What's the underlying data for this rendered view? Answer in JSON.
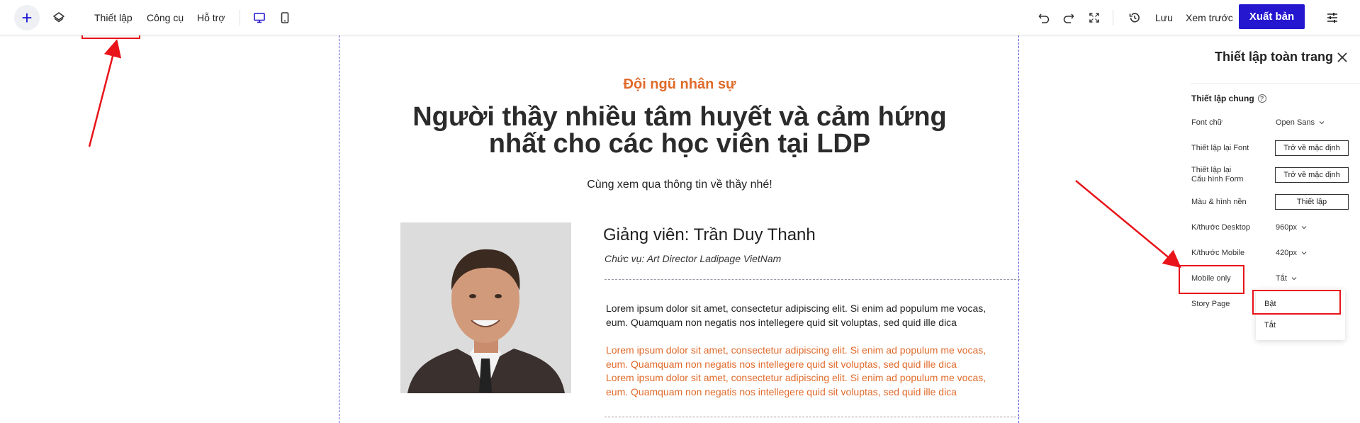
{
  "toolbar": {
    "add_label": "+",
    "menu": [
      "Thiết lập",
      "Công cụ",
      "Hỗ trợ"
    ],
    "save_label": "Lưu",
    "preview_label": "Xem trước",
    "publish_label": "Xuất bản",
    "icons": [
      "plus-icon",
      "layers-icon",
      "desktop-icon",
      "mobile-icon",
      "undo-icon",
      "redo-icon",
      "fullscreen-icon",
      "history-icon",
      "sliders-icon"
    ]
  },
  "canvas": {
    "subheading": "Đội ngũ nhân sự",
    "heading_line1": "Người thầy nhiều tâm huyết và cảm hứng",
    "heading_line2": "nhất cho các học viên tại LDP",
    "lead": "Cùng xem qua thông tin về thầy nhé!",
    "teacher_name": "Giảng viên: Trần Duy Thanh",
    "teacher_role": "Chức vụ: Art Director Ladipage VietNam",
    "para1": "Lorem ipsum dolor sit amet, consectetur adipiscing elit. Si enim ad populum me vocas, eum. Quamquam non negatis nos intellegere quid sit voluptas, sed quid ille dica",
    "para2": "Lorem ipsum dolor sit amet, consectetur adipiscing elit. Si enim ad populum me vocas, eum. Quamquam non negatis nos intellegere quid sit voluptas, sed quid ille dica",
    "para3": "Lorem ipsum dolor sit amet, consectetur adipiscing elit. Si enim ad populum me vocas, eum. Quamquam non negatis nos intellegere quid sit voluptas, sed quid ille dica"
  },
  "panel": {
    "title": "Thiết lập toàn trang",
    "section_title": "Thiết lập chung",
    "rows": {
      "font_label": "Font chữ",
      "font_value": "Open Sans",
      "reset_font_label": "Thiết lập lại Font",
      "reset_font_button": "Trở về mặc định",
      "reset_form_label_1": "Thiết lập lại",
      "reset_form_label_2": "Cấu hình Form",
      "reset_form_button": "Trở về mặc định",
      "color_label": "Màu & hình nền",
      "color_button": "Thiết lập",
      "desktop_label": "K/thước Desktop",
      "desktop_value": "960px",
      "mobile_label": "K/thước Mobile",
      "mobile_value": "420px",
      "mobile_only_label": "Mobile only",
      "mobile_only_value": "Tắt",
      "story_label": "Story Page"
    },
    "dropdown_options": [
      "Bật",
      "Tắt"
    ]
  },
  "colors": {
    "accent": "#2417cf",
    "orange": "#e06b2b",
    "annotation": "#e8141a"
  }
}
